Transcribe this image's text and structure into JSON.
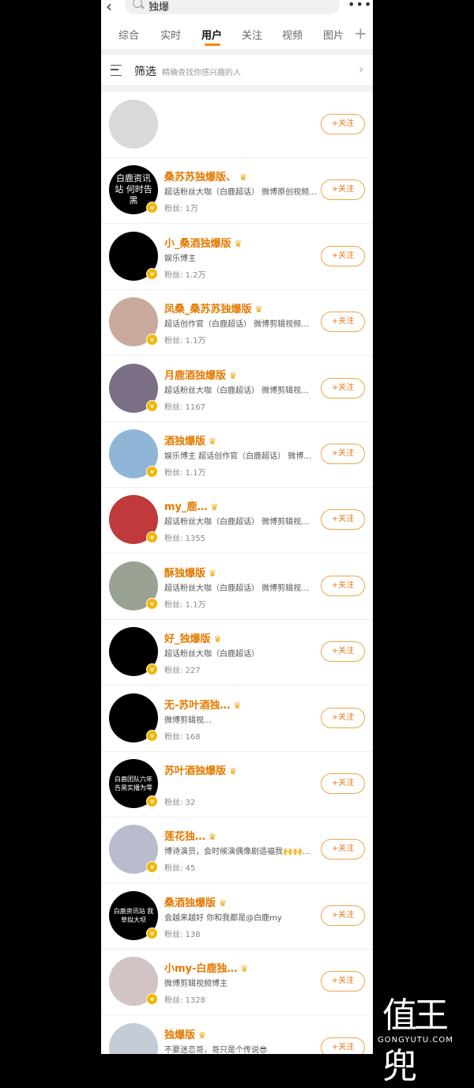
{
  "search": {
    "query": "独爆"
  },
  "tabs": [
    "综合",
    "实时",
    "用户",
    "关注",
    "视频",
    "图片"
  ],
  "filter": {
    "title": "筛选",
    "hint": "精确查找你感兴趣的人"
  },
  "follow_label": "+关注",
  "users": [
    {
      "name": "",
      "desc": "",
      "fans": "",
      "avatar_text": "",
      "avatar_color": "#d9d9d9"
    },
    {
      "name": "桑苏苏独爆版、",
      "desc": "超话粉丝大咖（白鹿超话） 微博原创视频…",
      "fans": "粉丝: 1万",
      "avatar_text": "白鹿资讯站 何时告黑",
      "avatar_color": "#000000"
    },
    {
      "name": "小_桑酒独爆版",
      "desc": "娱乐博主",
      "fans": "粉丝: 1.2万",
      "avatar_text": "",
      "avatar_color": "#000000"
    },
    {
      "name": "凤桑_桑苏苏独爆版",
      "desc": "超话创作官（白鹿超话） 微博剪辑视频…",
      "fans": "粉丝: 1.1万",
      "avatar_text": "",
      "avatar_color": "#c9a99b"
    },
    {
      "name": "月鹿酒独爆版",
      "desc": "超话粉丝大咖（白鹿超话） 微博剪辑视…",
      "fans": "粉丝: 1167",
      "avatar_text": "",
      "avatar_color": "#7b6f86"
    },
    {
      "name": "酒独爆版",
      "desc": "娱乐博主 超话创作官（白鹿超话） 微博…",
      "fans": "粉丝: 1.1万",
      "avatar_text": "",
      "avatar_color": "#8fb6d6"
    },
    {
      "name": "my_鹿…",
      "desc": "超话粉丝大咖（白鹿超话） 微博剪辑视…",
      "fans": "粉丝: 1355",
      "avatar_text": "",
      "avatar_color": "#c0393b"
    },
    {
      "name": "酥独爆版",
      "desc": "超话粉丝大咖（白鹿超话） 微博剪辑视…",
      "fans": "粉丝: 1.1万",
      "avatar_text": "",
      "avatar_color": "#9aa393"
    },
    {
      "name": "好_独爆版",
      "desc": "超话粉丝大咖（白鹿超话）",
      "fans": "粉丝: 227",
      "avatar_text": "",
      "avatar_color": "#000000"
    },
    {
      "name": "无-苏叶酒独…",
      "desc": "微博剪辑视…",
      "fans": "粉丝: 168",
      "avatar_text": "",
      "avatar_color": "#000000"
    },
    {
      "name": "苏叶酒独爆版",
      "desc": "",
      "fans": "粉丝: 32",
      "avatar_text": "白鹿团队六年 告黑实播为零",
      "avatar_color": "#000000"
    },
    {
      "name": "莲花独…",
      "desc": "博诗演员，会时候演偶像剧造福我🙌🙌…",
      "fans": "粉丝: 45",
      "avatar_text": "",
      "avatar_color": "#b8bccd"
    },
    {
      "name": "桑酒独爆版",
      "desc": "会越来越好 你和我都是@白鹿my",
      "fans": "粉丝: 138",
      "avatar_text": "白鹿资讯站 我草拟大坝",
      "avatar_color": "#000000"
    },
    {
      "name": "小my-白鹿独…",
      "desc": "微博剪辑视频博主",
      "fans": "粉丝: 1328",
      "avatar_text": "",
      "avatar_color": "#d2c3c5"
    },
    {
      "name": "独爆版",
      "desc": "不要迷恋哥，哥只是个传说😎",
      "fans": "",
      "avatar_text": "",
      "avatar_color": "#c4ccd8"
    }
  ],
  "watermark": {
    "big": "值王兜",
    "small": "GONGYUTU.COM"
  }
}
